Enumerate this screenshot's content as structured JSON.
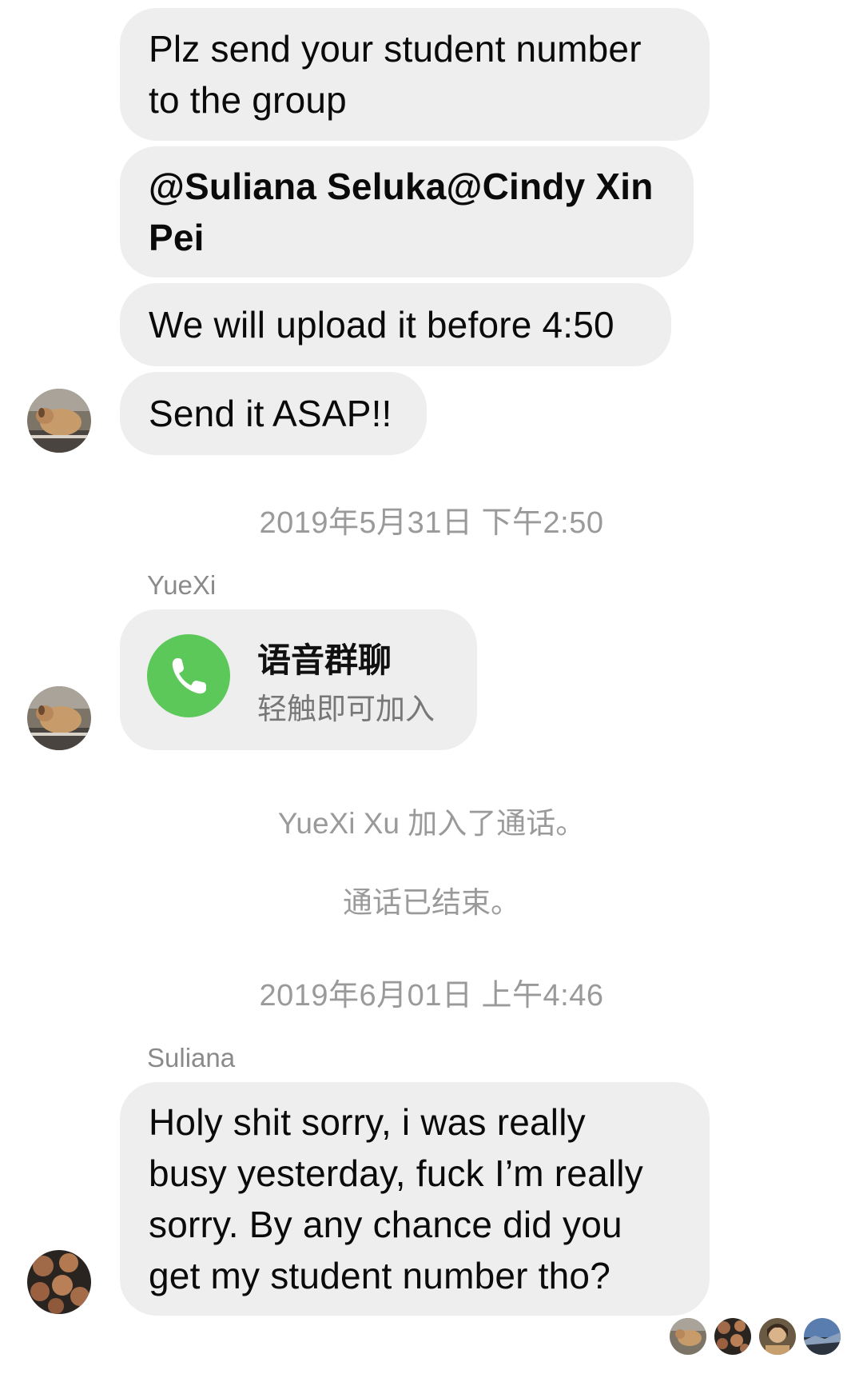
{
  "messages": {
    "m1": {
      "line1": "Plz send your student number",
      "line2": "to the group"
    },
    "m2": {
      "line1": "@Suliana Seluka@Cindy Xin",
      "line2": "Pei"
    },
    "m3": {
      "text": "We will upload it before 4:50"
    },
    "m4": {
      "text": "Send it ASAP!!"
    },
    "m5": {
      "line1": "Holy shit sorry, i was really",
      "line2": "busy yesterday, fuck I’m really",
      "line3": "sorry. By any chance did you",
      "line4": "get my student number tho?"
    }
  },
  "timestamps": {
    "t1": "2019年5月31日 下午2:50",
    "t2": "2019年6月01日 上午4:46"
  },
  "senders": {
    "s1": "YueXi",
    "s2": "Suliana"
  },
  "call": {
    "title": "语音群聊",
    "subtitle": "轻触即可加入",
    "icon": "phone-icon",
    "color": "#5cc85a"
  },
  "system": {
    "joined": "YueXi Xu 加入了通话。",
    "ended": "通话已结束。"
  },
  "colors": {
    "bubble": "#eeeeee",
    "meta_text": "#9a9a9a",
    "call_green": "#5cc85a"
  },
  "read_receipts": [
    "dog-avatar",
    "cookies-avatar",
    "person-avatar",
    "landscape-avatar"
  ]
}
